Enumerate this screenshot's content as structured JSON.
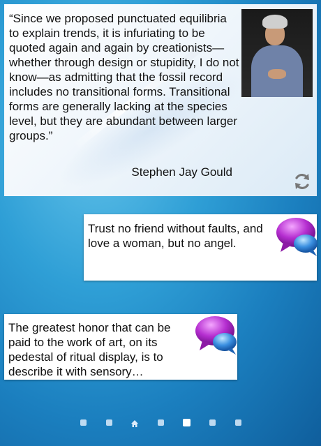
{
  "quote_widget": {
    "quote": "“Since we proposed punctuated equilibria to explain trends, it is infuriating to be quoted again and again by creationists—whether through design or stupidity, I do not know—as admitting that the fossil record includes no transitional forms. Transitional forms are generally lacking at the species level, but they are abundant between larger groups.”",
    "author": "Stephen Jay Gould",
    "refresh_icon": "refresh-icon"
  },
  "bubbles": [
    {
      "text": "Trust no friend without faults, and love a woman, but no angel.",
      "icon": "chat-bubbles-icon"
    },
    {
      "text": "The greatest honor that can be paid to the work of art, on its pedestal of ritual display, is to describe it with sensory…",
      "icon": "chat-bubbles-icon"
    }
  ],
  "pager": {
    "page_count": 7,
    "active_index": 4,
    "home_index": 2
  },
  "colors": {
    "chat_purple": "#b52ed0",
    "chat_blue": "#3a8fe0",
    "wallpaper": "#2f9fd6"
  }
}
